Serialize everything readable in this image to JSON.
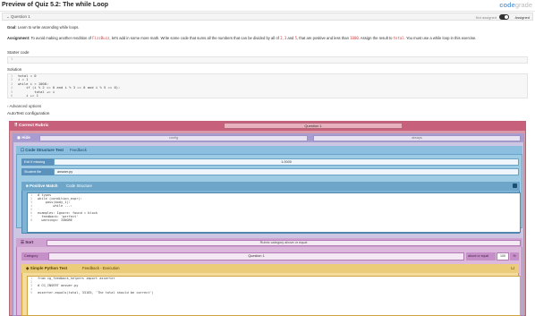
{
  "header": {
    "title": "Preview of Quiz 5.2: The while Loop",
    "logo_main": "code",
    "logo_rest": "grade"
  },
  "question_bar": {
    "label": "Question 1",
    "not_assigned": "Not assigned",
    "assigned": "Assigned"
  },
  "goal": {
    "label": "Goal:",
    "text": "Learn to write ascending while loops."
  },
  "assignment": {
    "label": "Assignment:",
    "text_a": "To avoid making another rendition of ",
    "code_a": "FizzBuzz",
    "text_b": ", let's add in some more math. Write some code that sums all the numbers that can be divided by all of ",
    "code_b": "2",
    "text_c": ", ",
    "code_c": "3",
    "text_d": " and ",
    "code_d": "5",
    "text_e": ", that are positive and less than ",
    "code_e": "1000",
    "text_f": ". Assign the result to ",
    "code_f": "total",
    "text_g": ". You must use a while loop in this exercise."
  },
  "starter": {
    "label": "Starter code",
    "lines": [
      ""
    ]
  },
  "solution": {
    "label": "Solution",
    "lines": [
      "total = 0",
      "i = 1",
      "while i < 1000:",
      "    if (i % 2 == 0 and i % 3 == 0 and i % 5 == 0):",
      "        total += i",
      "    i += 1"
    ]
  },
  "advanced": "Advanced options",
  "autotest": "AutoTest configuration",
  "rules": {
    "correct": {
      "title": "Correct Rubric",
      "question": "Question 1"
    },
    "hide": {
      "title": "Hide",
      "select1": "config",
      "select2": "always"
    },
    "code_structure": {
      "title": "Code Structure Test",
      "feedback": "Feedback",
      "rows": [
        {
          "key": "Exit if missing",
          "value": "1.0000"
        },
        {
          "key": "Student file",
          "value": "answer.py"
        }
      ]
    },
    "positive_match": {
      "title": "Positive Match",
      "feedback": "Code Structure",
      "lines": [
        "# types",
        "while (condition_expr):",
        "    pass(body_1):",
        "        while ...:",
        "",
        "examples: Ignore: found = block",
        "  feedback: 'perfect'",
        "  warnings: IGNORE"
      ]
    },
    "sort": {
      "title": "Sort",
      "select": "Rubric category above or equal",
      "category_label": "Category",
      "category_value": "Question 1",
      "above_label": "above or equal",
      "percent_value": "100",
      "percent_sign": "%"
    },
    "python": {
      "title": "Simple Python Test",
      "feedback": "Feedback - Execution",
      "lines": [
        "from cg_feedback_helpers import asserter",
        "",
        "# CG_INSERT answer.py",
        "",
        "asserter.equals(total, 33165, 'The total should be correct')"
      ]
    }
  }
}
